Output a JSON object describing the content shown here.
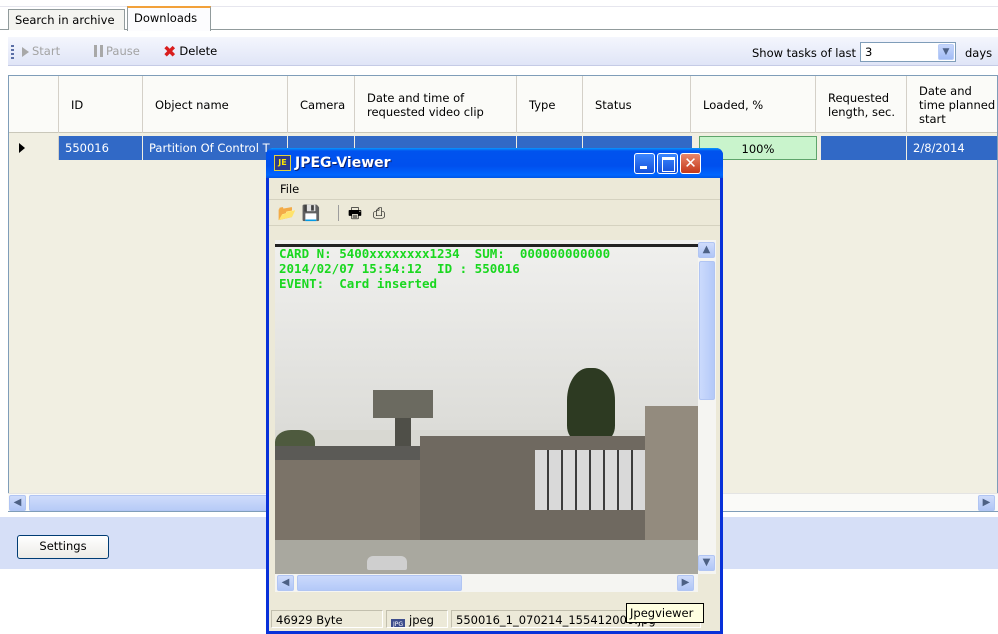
{
  "tabs": [
    {
      "label": "Search in archive",
      "active": false
    },
    {
      "label": "Downloads",
      "active": true
    }
  ],
  "toolbar": {
    "start_label": "Start",
    "pause_label": "Pause",
    "delete_label": "Delete",
    "show_tasks_label": "Show tasks of last",
    "days_value": "3",
    "days_label": "days"
  },
  "grid": {
    "columns": [
      "ID",
      "Object name",
      "Camera",
      "Date and time of requested video clip",
      "Type",
      "Status",
      "Loaded, %",
      "Requested length, sec.",
      "Date and time planned start"
    ],
    "rows": [
      {
        "id": "550016",
        "object_name": "Partition Of Control T",
        "camera": "",
        "date": "",
        "type": "",
        "status": "",
        "loaded": "100%",
        "length": "",
        "planned_start": "2/8/2014"
      }
    ]
  },
  "settings_label": "Settings",
  "viewer": {
    "title": "JPEG-Viewer",
    "menu_file": "File",
    "overlay": [
      "CARD N: 5400xxxxxxxx1234  SUM:  000000000000",
      "2014/02/07 15:54:12  ID : 550016",
      "EVENT:  Card inserted"
    ],
    "status_size": "46929 Byte",
    "status_type": "jpeg",
    "status_file": "550016_1_070214_155412000.jpg"
  },
  "tooltip": "Jpegviewer",
  "icons": {
    "start": "play-icon",
    "pause": "pause-icon",
    "delete": "delete-x-icon",
    "open": "open-folder-icon",
    "save": "save-icon",
    "print": "print-icon",
    "print_preview": "print-preview-icon"
  }
}
